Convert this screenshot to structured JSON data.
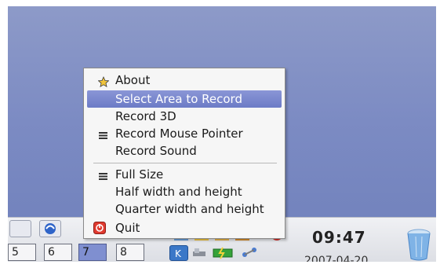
{
  "menu": {
    "items": [
      {
        "label": "About",
        "icon": "star-icon"
      },
      {
        "label": "Select Area to Record",
        "highlighted": true
      },
      {
        "label": "Record 3D"
      },
      {
        "label": "Record Mouse Pointer",
        "icon": "checkmark-lines-icon"
      },
      {
        "label": "Record Sound"
      },
      {
        "label": "Full Size",
        "icon": "checkmark-lines-icon"
      },
      {
        "label": "Half width and height"
      },
      {
        "label": "Quarter width and height"
      },
      {
        "label": "Quit",
        "icon": "quit-icon"
      }
    ]
  },
  "pager": {
    "desktops": [
      "5",
      "6",
      "7",
      "8"
    ],
    "active": "7"
  },
  "clock": {
    "time": "09:47",
    "date": "2007-04-20"
  },
  "colors": {
    "desktop": "#7c8bc3",
    "highlight": "#7483cb",
    "quit_red": "#e03a2f"
  }
}
